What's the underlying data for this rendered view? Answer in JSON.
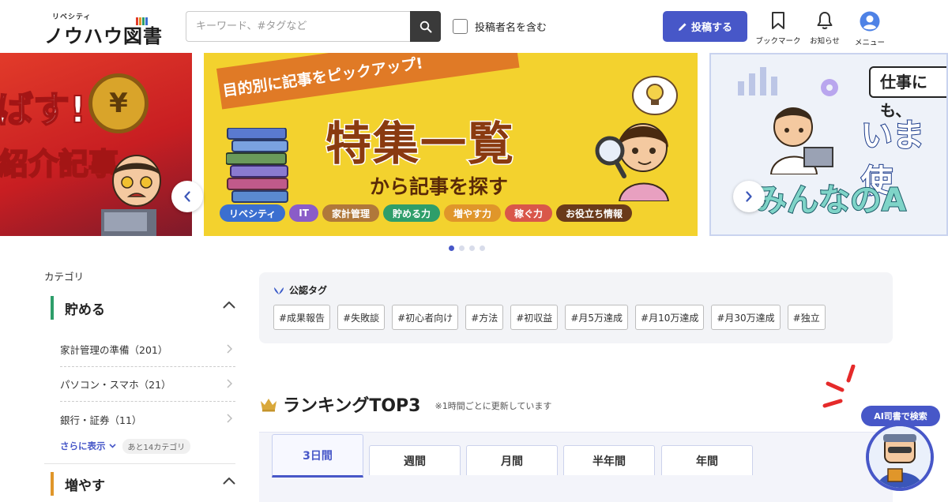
{
  "header": {
    "logo_small": "リベシティ",
    "logo_main": "ノウハウ図書館",
    "search_placeholder": "キーワード、#タグなど",
    "author_check_label": "投稿者名を含む",
    "post_label": "投稿する",
    "bookmark_label": "ブックマーク",
    "notice_label": "お知らせ",
    "menu_label": "メニュー",
    "accent_color": "#4757c8"
  },
  "carousel": {
    "left": {
      "line1": "ばす!",
      "line2": "紹介記事",
      "coin": "¥"
    },
    "center": {
      "ribbon": "目的別に記事をピックアップ!",
      "title": "特集一覧",
      "subtitle": "から記事を探す",
      "tags": [
        {
          "label": "リベシティ",
          "color": "#3b6fd0"
        },
        {
          "label": "IT",
          "color": "#8a5cc8"
        },
        {
          "label": "家計管理",
          "color": "#b0783a"
        },
        {
          "label": "貯める力",
          "color": "#2e9e6a"
        },
        {
          "label": "増やす力",
          "color": "#e0962a"
        },
        {
          "label": "稼ぐ力",
          "color": "#d9574a"
        },
        {
          "label": "お役立ち情報",
          "color": "#6a3a1a"
        }
      ]
    },
    "right": {
      "ribbon": "仕事にも、",
      "line1": "いま使",
      "line2": "みんなのA"
    },
    "slide_count": 4,
    "active_slide": 0
  },
  "sidebar": {
    "heading": "カテゴリ",
    "categories": [
      {
        "label": "貯める",
        "items": [
          {
            "label": "家計管理の準備（201）"
          },
          {
            "label": "パソコン・スマホ（21）"
          },
          {
            "label": "銀行・証券（11）"
          }
        ],
        "more_label": "さらに表示",
        "more_count": "あと14カテゴリ"
      },
      {
        "label": "増やす"
      }
    ]
  },
  "official_tags": {
    "title": "公認タグ",
    "tags": [
      "#成果報告",
      "#失敗談",
      "#初心者向け",
      "#方法",
      "#初収益",
      "#月5万達成",
      "#月10万達成",
      "#月30万達成",
      "#独立"
    ]
  },
  "ranking": {
    "title": "ランキングTOP3",
    "note": "※1時間ごとに更新しています",
    "tabs": [
      {
        "label": "3日間",
        "active": true
      },
      {
        "label": "週間",
        "active": false
      },
      {
        "label": "月間",
        "active": false
      },
      {
        "label": "半年間",
        "active": false
      },
      {
        "label": "年間",
        "active": false
      }
    ]
  },
  "ai_search": {
    "label": "AI司書で検索"
  }
}
